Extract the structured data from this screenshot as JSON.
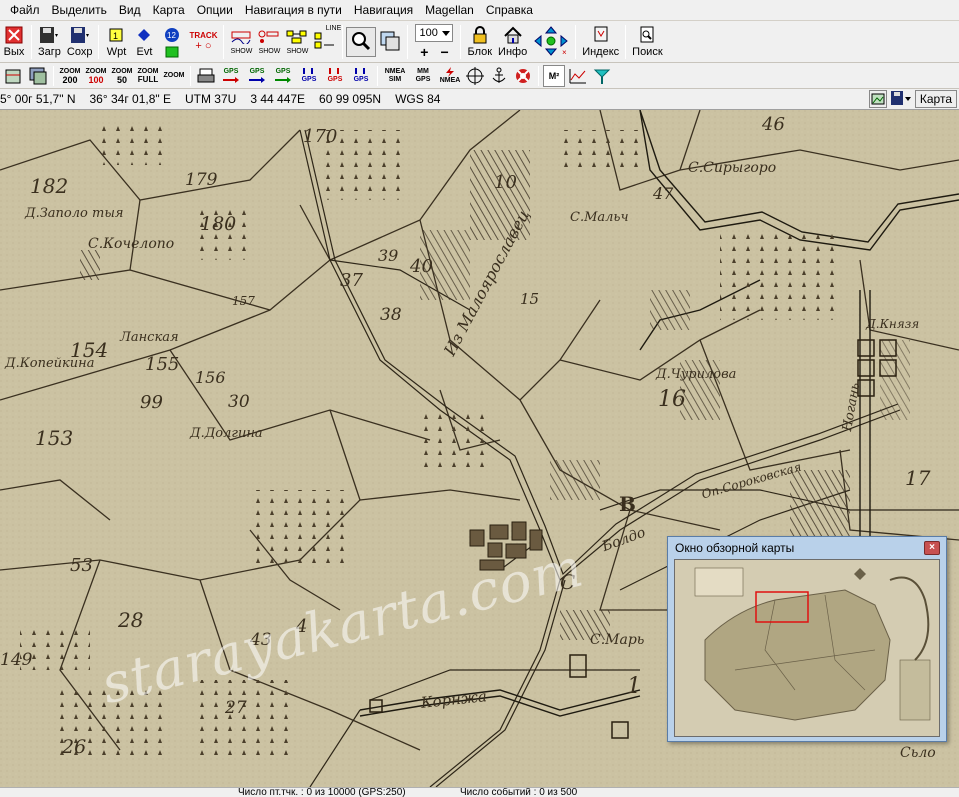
{
  "menu": [
    "Файл",
    "Выделить",
    "Вид",
    "Карта",
    "Опции",
    "Навигация в пути",
    "Навигация",
    "Magellan",
    "Справка"
  ],
  "toolbar": {
    "exit": "Вых",
    "load": "Загр",
    "save": "Сохр",
    "wpt": "Wpt",
    "evt": "Evt",
    "track_label": "TRACK",
    "show1": "SHOW",
    "show2": "SHOW",
    "show3": "SHOW",
    "line": "LINE",
    "zoom_value": "100",
    "block": "Блок",
    "info": "Инфо",
    "index": "Индекс",
    "search": "Поиск"
  },
  "toolbar2": {
    "zoom_buttons": [
      {
        "top": "ZOOM",
        "bottom": "200"
      },
      {
        "top": "ZOOM",
        "bottom": "100"
      },
      {
        "top": "ZOOM",
        "bottom": "50"
      },
      {
        "top": "ZOOM",
        "bottom": "FULL"
      },
      {
        "top": "ZOOM",
        "bottom": ""
      }
    ],
    "gps_labels": [
      "GPS",
      "GPS",
      "GPS",
      "GPS",
      "GPS",
      "GPS"
    ],
    "nmea_sim": "NMEA SIM",
    "mm_gps": "MM GPS",
    "nmea": "NMEA",
    "m2": "M²"
  },
  "coords": {
    "lat": "5° 00г 51,7\" N",
    "lon": "36° 34г 01,8\" E",
    "utm": "UTM  37U",
    "easting": "3 44 447E",
    "northing": "60 99 095N",
    "datum": "WGS 84",
    "map_button": "Карта"
  },
  "map": {
    "labels": [
      "182",
      "179",
      "180",
      "170",
      "10",
      "46",
      "47",
      "40",
      "37",
      "39",
      "38",
      "15",
      "154",
      "155",
      "156",
      "157",
      "30",
      "99",
      "153",
      "16",
      "17",
      "53",
      "4",
      "1",
      "В",
      "С",
      "28",
      "43",
      "26",
      "27",
      "149",
      "С.Сирыгоро",
      "Д.Заполо тыя",
      "С.Кочелопо",
      "Ланская",
      "Д.Копейкина",
      "Д.Долгина",
      "Из Малоярославец",
      "С.Мальч",
      "Д.Чурилова",
      "Д.Князя",
      "Оп.Сороковская",
      "Ногань",
      "Корнжа",
      "С.Марь",
      "Болдо",
      "Сьло"
    ],
    "watermark": "starayakarta.com"
  },
  "overview": {
    "title": "Окно обзорной карты",
    "close": "×"
  },
  "status": {
    "points": "Число пт.тчк. : 0 из 10000  (GPS:250)",
    "events": "Число событий : 0 из 500"
  }
}
